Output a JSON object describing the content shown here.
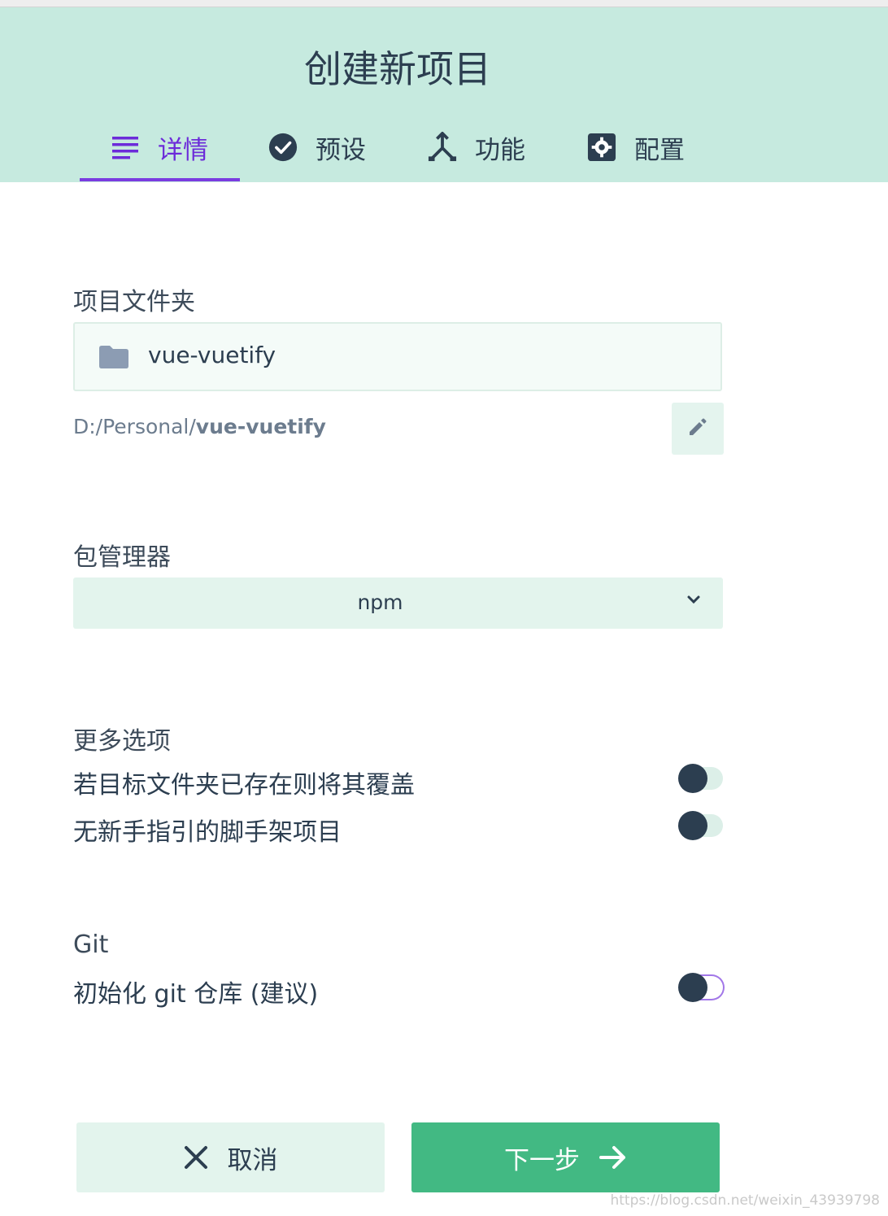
{
  "dialog": {
    "title": "创建新项目"
  },
  "tabs": [
    {
      "label": "详情",
      "icon": "list-icon",
      "active": true
    },
    {
      "label": "预设",
      "icon": "check-circle-icon"
    },
    {
      "label": "功能",
      "icon": "call-split-icon"
    },
    {
      "label": "配置",
      "icon": "settings-box-icon"
    }
  ],
  "folder": {
    "label": "项目文件夹",
    "value": "vue-vuetify",
    "path_prefix": "D:/Personal/",
    "path_name": "vue-vuetify"
  },
  "package_manager": {
    "label": "包管理器",
    "selected": "npm"
  },
  "more_options": {
    "label": "更多选项",
    "items": [
      {
        "label": "若目标文件夹已存在则将其覆盖",
        "checked": false
      },
      {
        "label": "无新手指引的脚手架项目",
        "checked": false
      }
    ]
  },
  "git": {
    "label": "Git",
    "init_label": "初始化 git 仓库 (建议)",
    "checked": false
  },
  "actions": {
    "cancel_label": "取消",
    "next_label": "下一步"
  },
  "watermark": "https://blog.csdn.net/weixin_43939798",
  "colors": {
    "header_bg": "#c6eadf",
    "active_tab": "#6c2bd9",
    "primary": "#42b983",
    "text": "#2c3e50"
  }
}
